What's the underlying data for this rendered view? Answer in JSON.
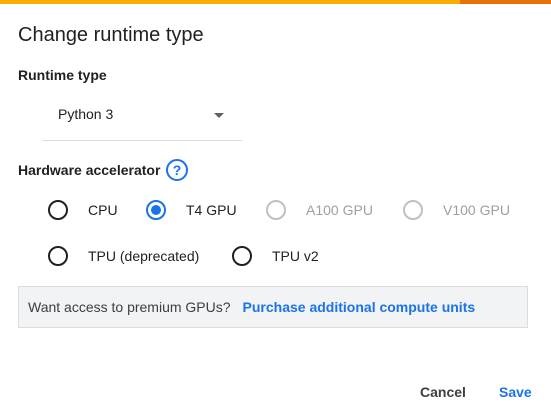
{
  "colors": {
    "accent": "#1a73e8",
    "top_bar_primary": "#f9ab00",
    "top_bar_secondary": "#e8710a",
    "promo_background": "#f1f3f4"
  },
  "dialog": {
    "title": "Change runtime type"
  },
  "runtime": {
    "label": "Runtime type",
    "selected": "Python 3"
  },
  "hardware": {
    "label": "Hardware accelerator",
    "help_icon": "?",
    "options": [
      {
        "label": "CPU",
        "checked": false,
        "disabled": false
      },
      {
        "label": "T4 GPU",
        "checked": true,
        "disabled": false
      },
      {
        "label": "A100 GPU",
        "checked": false,
        "disabled": true
      },
      {
        "label": "V100 GPU",
        "checked": false,
        "disabled": true
      },
      {
        "label": "TPU (deprecated)",
        "checked": false,
        "disabled": false
      },
      {
        "label": "TPU v2",
        "checked": false,
        "disabled": false
      }
    ]
  },
  "promo": {
    "text": "Want access to premium GPUs?",
    "link": "Purchase additional compute units"
  },
  "actions": {
    "cancel": "Cancel",
    "save": "Save"
  }
}
